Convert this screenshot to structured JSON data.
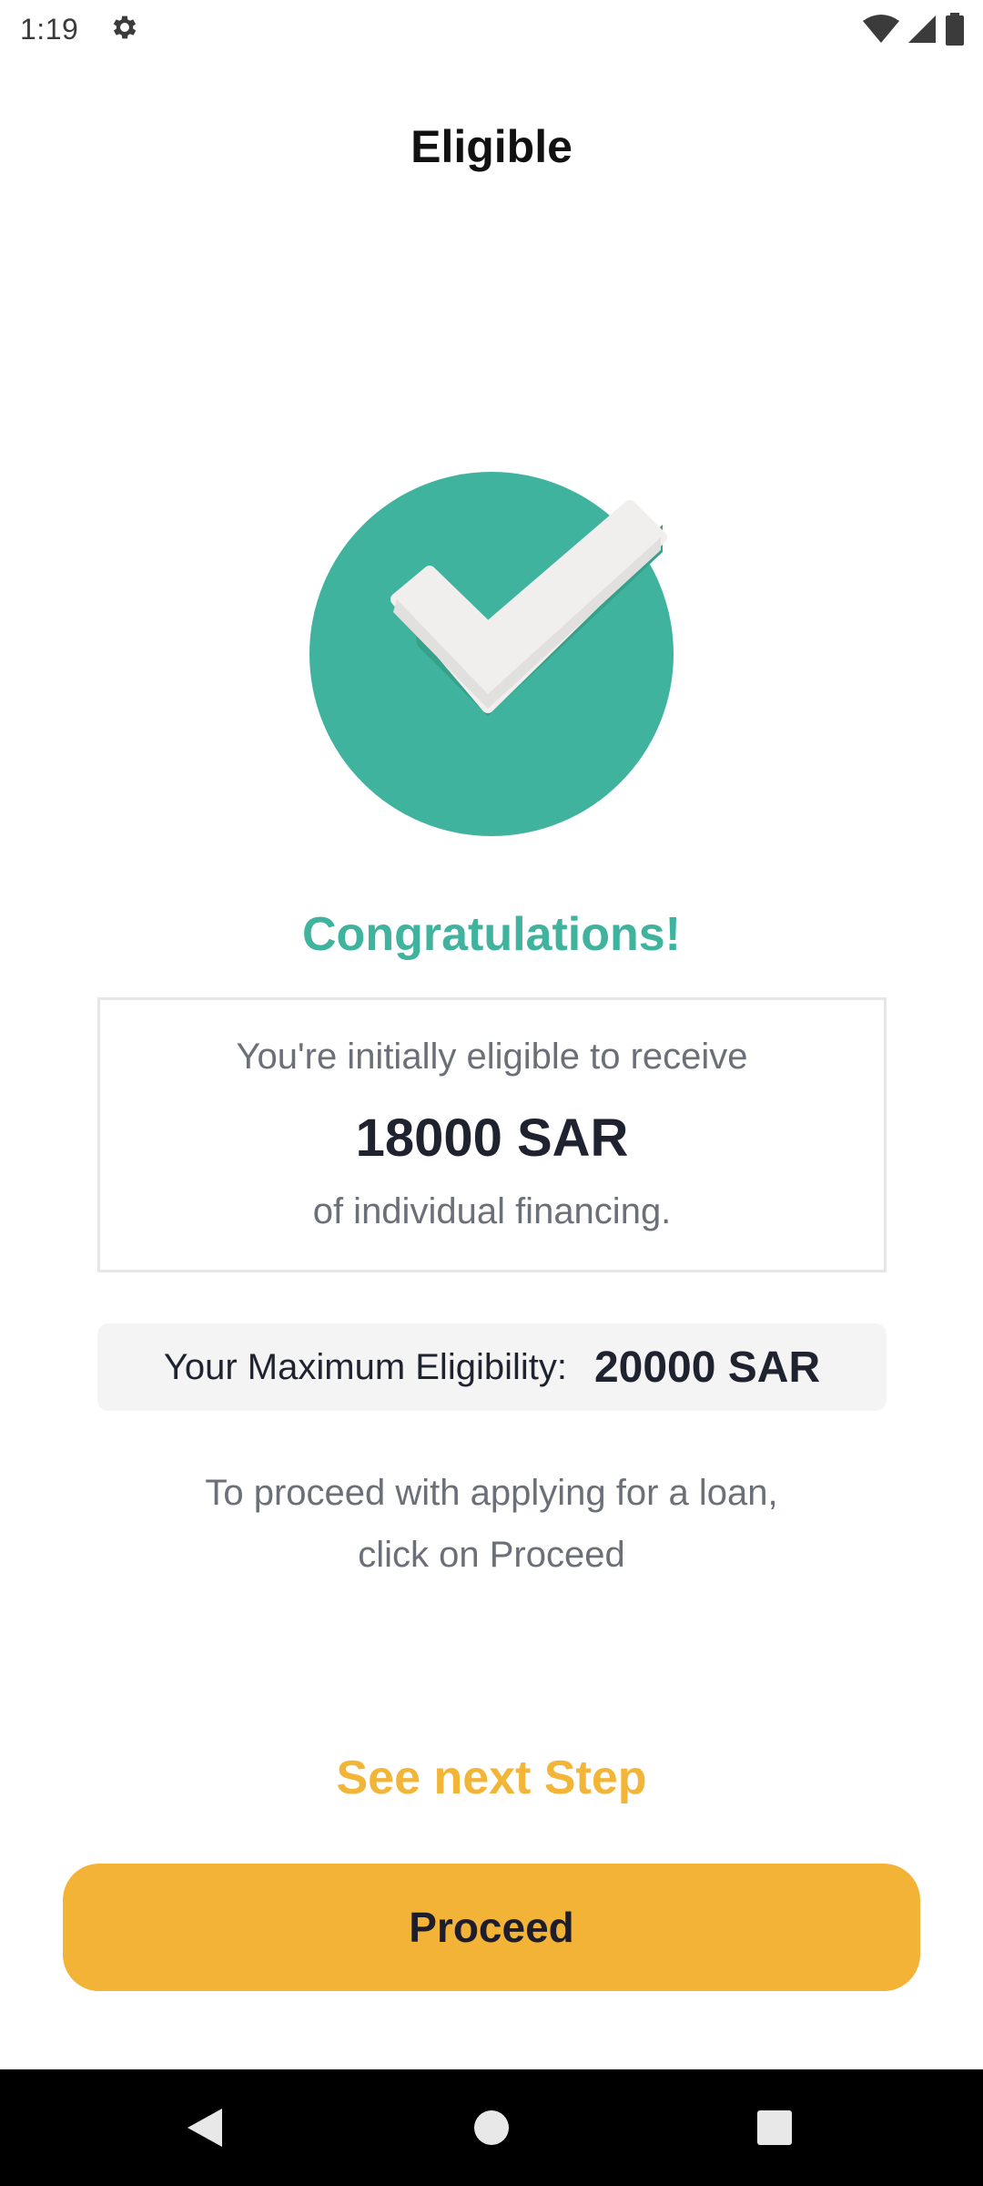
{
  "status_bar": {
    "time": "1:19",
    "icons": [
      "settings-icon",
      "wifi-icon",
      "cell-signal-icon",
      "battery-icon"
    ]
  },
  "header": {
    "title": "Eligible"
  },
  "illustration": {
    "icon": "check-circle-icon",
    "circle_color": "#3fb39d",
    "check_color": "#f0efee"
  },
  "result": {
    "heading": "Congratulations!",
    "card": {
      "line1": "You're initially eligible to receive",
      "amount": "18000 SAR",
      "line3": "of individual financing."
    },
    "max_eligibility": {
      "label": "Your Maximum Eligibility:",
      "value": "20000 SAR"
    },
    "instructions_line1": "To proceed with applying for a loan,",
    "instructions_line2": "click on Proceed"
  },
  "actions": {
    "next_step_label": "See next Step",
    "proceed_label": "Proceed",
    "accent_color": "#f3b337"
  },
  "nav_bar": {
    "icons": [
      "back-icon",
      "home-icon",
      "recents-icon"
    ]
  }
}
